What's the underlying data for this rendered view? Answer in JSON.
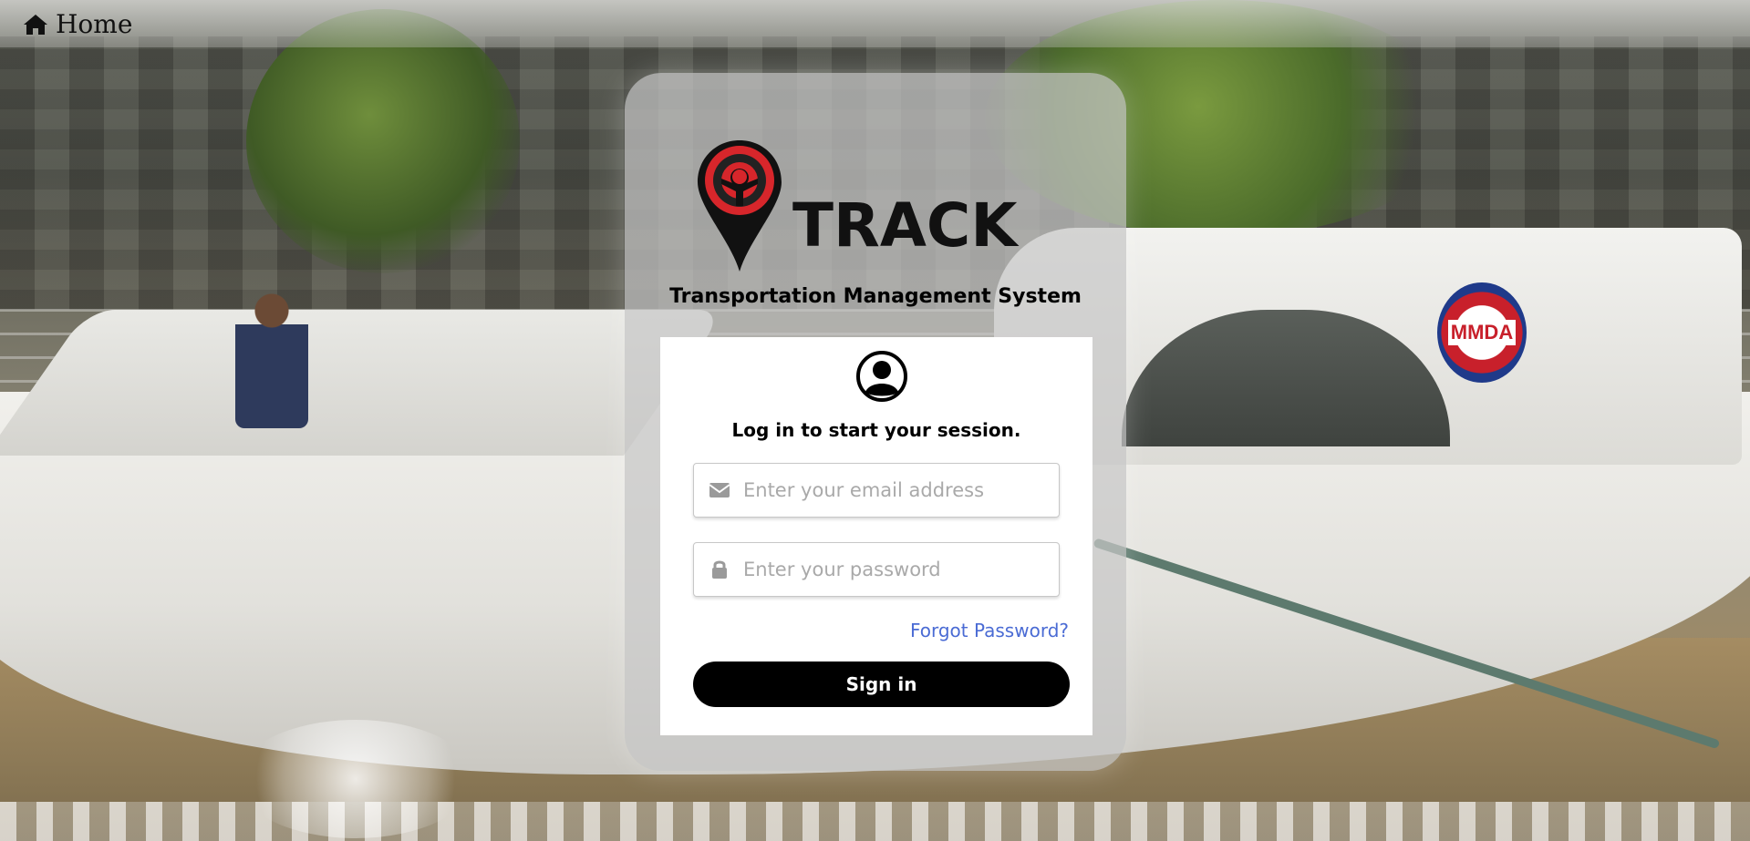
{
  "nav": {
    "home_label": "Home",
    "home_icon": "home-icon"
  },
  "brand": {
    "logo_text": "TRACK",
    "subtitle": "Transportation Management System",
    "accent": "#d7262b"
  },
  "login": {
    "heading": "Log in to start your session.",
    "email_placeholder": "Enter your email address",
    "email_icon": "envelope-icon",
    "password_placeholder": "Enter your password",
    "password_icon": "lock-icon",
    "forgot_label": "Forgot Password?",
    "signin_label": "Sign in",
    "user_icon": "user-circle-icon",
    "link_color": "#4a6bd4"
  },
  "background": {
    "seal_text": "MMDA"
  }
}
